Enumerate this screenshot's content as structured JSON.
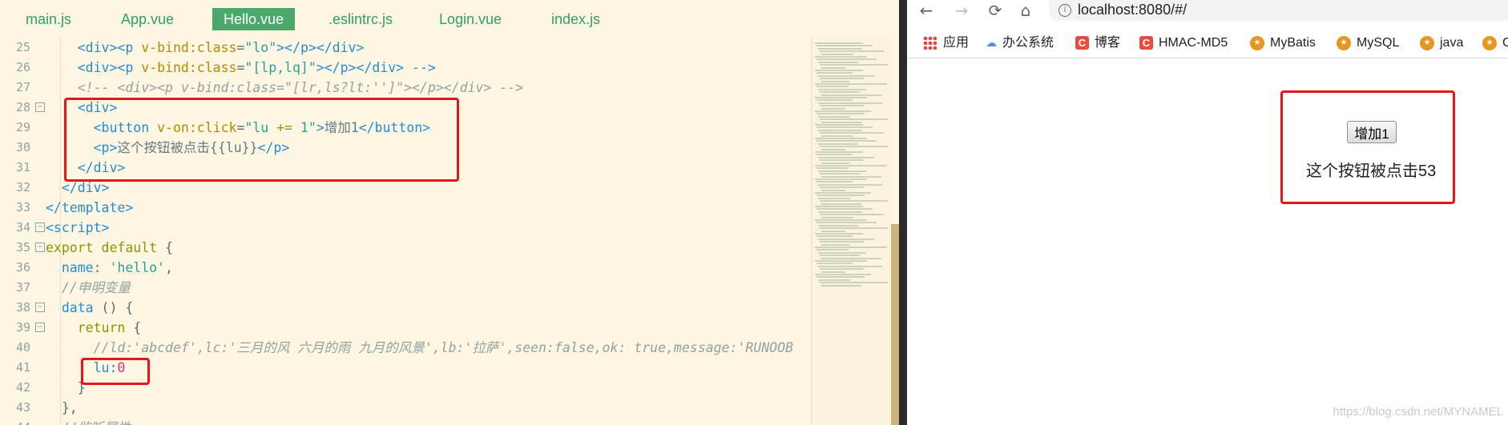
{
  "editor": {
    "tabs": [
      "main.js",
      "App.vue",
      "Hello.vue",
      ".eslintrc.js",
      "Login.vue",
      "index.js"
    ],
    "active_tab": "Hello.vue",
    "lines": [
      {
        "num": "25",
        "fold": "",
        "tokens": [
          [
            "    ",
            "plain"
          ],
          [
            "<div><p ",
            "tag"
          ],
          [
            "v-bind:class",
            "attr"
          ],
          [
            "=",
            "punc"
          ],
          [
            "\"lo\"",
            "str"
          ],
          [
            "></p></div>",
            "tag"
          ]
        ]
      },
      {
        "num": "26",
        "fold": "",
        "tokens": [
          [
            "    ",
            "plain"
          ],
          [
            "<div><p ",
            "tag"
          ],
          [
            "v-bind:class",
            "attr"
          ],
          [
            "=",
            "punc"
          ],
          [
            "\"[lp,lq]\"",
            "str"
          ],
          [
            "></p></div> -->",
            "tag"
          ]
        ]
      },
      {
        "num": "27",
        "fold": "",
        "tokens": [
          [
            "    ",
            "plain"
          ],
          [
            "<!-- <div><p v-bind:class=\"[lr,ls?lt:'']\"></p></div> -->",
            "cmt"
          ]
        ]
      },
      {
        "num": "28",
        "fold": "−",
        "tokens": [
          [
            "    ",
            "plain"
          ],
          [
            "<div>",
            "tag"
          ]
        ]
      },
      {
        "num": "29",
        "fold": "",
        "tokens": [
          [
            "      ",
            "plain"
          ],
          [
            "<button ",
            "tag"
          ],
          [
            "v-on:click",
            "attr"
          ],
          [
            "=",
            "punc"
          ],
          [
            "\"lu ",
            "str"
          ],
          [
            "+=",
            "kw"
          ],
          [
            " 1\"",
            "str"
          ],
          [
            ">",
            "tag"
          ],
          [
            "增加1",
            "plain"
          ],
          [
            "</button>",
            "tag"
          ]
        ]
      },
      {
        "num": "30",
        "fold": "",
        "tokens": [
          [
            "      ",
            "plain"
          ],
          [
            "<p>",
            "tag"
          ],
          [
            "这个按钮被点击{{lu}}",
            "plain"
          ],
          [
            "</p>",
            "tag"
          ]
        ]
      },
      {
        "num": "31",
        "fold": "",
        "tokens": [
          [
            "    ",
            "plain"
          ],
          [
            "</div>",
            "tag"
          ]
        ]
      },
      {
        "num": "32",
        "fold": "",
        "tokens": [
          [
            "  ",
            "plain"
          ],
          [
            "</div>",
            "tag"
          ]
        ]
      },
      {
        "num": "33",
        "fold": "",
        "tokens": [
          [
            "</template>",
            "tag"
          ]
        ]
      },
      {
        "num": "34",
        "fold": "−",
        "tokens": [
          [
            "<script>",
            "tag"
          ]
        ]
      },
      {
        "num": "35",
        "fold": "−",
        "tokens": [
          [
            "export default",
            "kw"
          ],
          [
            " {",
            "punc"
          ]
        ]
      },
      {
        "num": "36",
        "fold": "",
        "tokens": [
          [
            "  ",
            "plain"
          ],
          [
            "name",
            "key"
          ],
          [
            ": ",
            "punc"
          ],
          [
            "'hello'",
            "str"
          ],
          [
            ",",
            "punc"
          ]
        ]
      },
      {
        "num": "37",
        "fold": "",
        "tokens": [
          [
            "  ",
            "plain"
          ],
          [
            "//申明变量",
            "cmt"
          ]
        ]
      },
      {
        "num": "38",
        "fold": "−",
        "tokens": [
          [
            "  ",
            "plain"
          ],
          [
            "data",
            "key"
          ],
          [
            " () {",
            "punc"
          ]
        ]
      },
      {
        "num": "39",
        "fold": "−",
        "tokens": [
          [
            "    ",
            "plain"
          ],
          [
            "return",
            "kw"
          ],
          [
            " {",
            "punc"
          ]
        ]
      },
      {
        "num": "40",
        "fold": "",
        "tokens": [
          [
            "      ",
            "plain"
          ],
          [
            "//ld:'abcdef',lc:'三月的风 六月的雨 九月的风景',lb:'拉萨',seen:false,ok: true,message:'RUNOOB",
            "cmt"
          ]
        ]
      },
      {
        "num": "41",
        "fold": "",
        "tokens": [
          [
            "      ",
            "plain"
          ],
          [
            "lu",
            "key"
          ],
          [
            ":",
            "punc"
          ],
          [
            "0",
            "num"
          ]
        ]
      },
      {
        "num": "42",
        "fold": "",
        "tokens": [
          [
            "    ",
            "plain"
          ],
          [
            "}",
            "punc"
          ]
        ]
      },
      {
        "num": "43",
        "fold": "",
        "tokens": [
          [
            "  ",
            "plain"
          ],
          [
            "},",
            "punc"
          ]
        ]
      },
      {
        "num": "44",
        "fold": "",
        "tokens": [
          [
            "  ",
            "plain"
          ],
          [
            "//监听属性",
            "cmt"
          ]
        ]
      }
    ]
  },
  "browser": {
    "nav": {
      "back": "←",
      "forward": "→",
      "reload": "⟳",
      "home": "⌂"
    },
    "info_icon": "i",
    "url": "localhost:8080/#/",
    "bookmarks": [
      {
        "label": "应用",
        "icon": "apps-grid-icon"
      },
      {
        "label": "办公系统",
        "icon": "cloud-icon"
      },
      {
        "label": "博客",
        "icon": "csdn-c-icon"
      },
      {
        "label": "HMAC-MD5",
        "icon": "csdn-c-icon"
      },
      {
        "label": "MyBatis",
        "icon": "mybatis-icon"
      },
      {
        "label": "MySQL",
        "icon": "mybatis-icon"
      },
      {
        "label": "java",
        "icon": "mybatis-icon"
      },
      {
        "label": "C",
        "icon": "mybatis-icon"
      }
    ],
    "app": {
      "button_label": "增加1",
      "click_text": "这个按钮被点击53"
    },
    "watermark": "https://blog.csdn.net/MYNAMEL"
  },
  "colors": {
    "highlight": "#e8141c",
    "active_tab_bg": "#4aa86b",
    "editor_bg": "#fdf6e3"
  }
}
